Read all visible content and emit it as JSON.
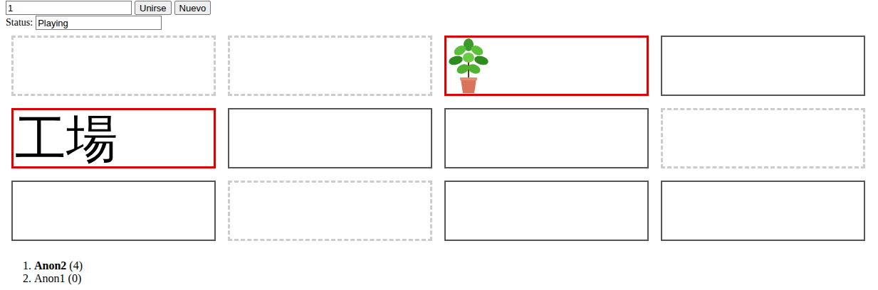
{
  "game": {
    "id_value": "1",
    "buttons": [
      "Unirse",
      "Nuevo"
    ]
  },
  "status": {
    "label": "Status:",
    "value": "Playing"
  },
  "cards": [
    {
      "state": "removed",
      "selected": false,
      "kind": "blank",
      "text": ""
    },
    {
      "state": "removed",
      "selected": false,
      "kind": "blank",
      "text": ""
    },
    {
      "state": "open",
      "selected": true,
      "kind": "picture",
      "text": ""
    },
    {
      "state": "hidden",
      "selected": false,
      "kind": "blank",
      "text": ""
    },
    {
      "state": "open",
      "selected": true,
      "kind": "word",
      "text": "工場"
    },
    {
      "state": "hidden",
      "selected": false,
      "kind": "blank",
      "text": ""
    },
    {
      "state": "hidden",
      "selected": false,
      "kind": "blank",
      "text": ""
    },
    {
      "state": "removed",
      "selected": false,
      "kind": "blank",
      "text": ""
    },
    {
      "state": "hidden",
      "selected": false,
      "kind": "blank",
      "text": ""
    },
    {
      "state": "removed",
      "selected": false,
      "kind": "blank",
      "text": ""
    },
    {
      "state": "hidden",
      "selected": false,
      "kind": "blank",
      "text": ""
    },
    {
      "state": "hidden",
      "selected": false,
      "kind": "blank",
      "text": ""
    }
  ],
  "players": [
    {
      "rank": "1.",
      "name": "Anon2",
      "score": "(4)",
      "bold": true
    },
    {
      "rank": "2.",
      "name": "Anon1",
      "score": "(0)",
      "bold": false
    }
  ]
}
